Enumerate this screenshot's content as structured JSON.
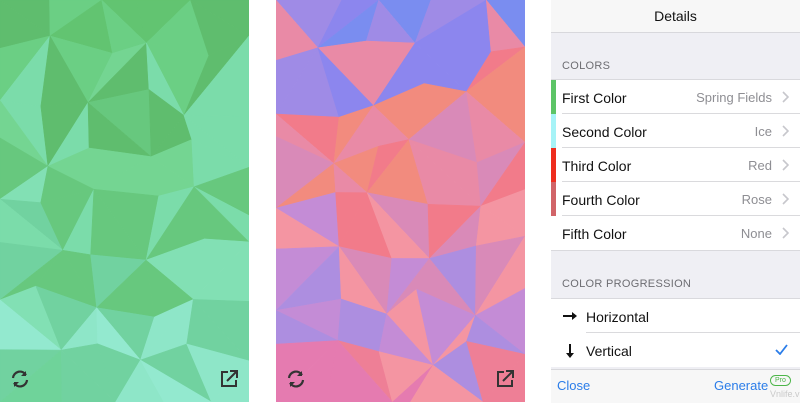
{
  "phone_green": {
    "palette": [
      "#62c471",
      "#6bcf84",
      "#5fbd6e",
      "#74d592",
      "#7bdcaa",
      "#67c87e",
      "#82e0b4",
      "#71d2a0",
      "#8ee6c8",
      "#93e9cf",
      "#6fd39a",
      "#79dbb6"
    ]
  },
  "phone_pink": {
    "palette": [
      "#7a8df0",
      "#8c86ee",
      "#9f8be6",
      "#e98aa6",
      "#f27b8a",
      "#f28b7e",
      "#d98ab8",
      "#c48cd6",
      "#f495a2",
      "#ee7f96",
      "#ad8ee0",
      "#f6a08c",
      "#e57bb0",
      "#7f9bf2"
    ]
  },
  "details": {
    "nav_title": "Details",
    "colors_header": "COLORS",
    "color_rows": [
      {
        "label": "First Color",
        "value": "Spring Fields",
        "swatch": "#5cc466"
      },
      {
        "label": "Second Color",
        "value": "Ice",
        "swatch": "#a6f3f7"
      },
      {
        "label": "Third Color",
        "value": "Red",
        "swatch": "#ee2d1e"
      },
      {
        "label": "Fourth Color",
        "value": "Rose",
        "swatch": "#d16468"
      },
      {
        "label": "Fifth Color",
        "value": "None",
        "swatch": ""
      }
    ],
    "progression_header": "COLOR PROGRESSION",
    "progression_rows": [
      {
        "label": "Horizontal",
        "selected": false
      },
      {
        "label": "Vertical",
        "selected": true
      }
    ],
    "close_label": "Close",
    "generate_label": "Generate",
    "pro_badge": "Pro"
  },
  "colors": {
    "accent": "#2b7de9",
    "pro_green": "#4cb648"
  },
  "watermark": "Vnlife.vn"
}
